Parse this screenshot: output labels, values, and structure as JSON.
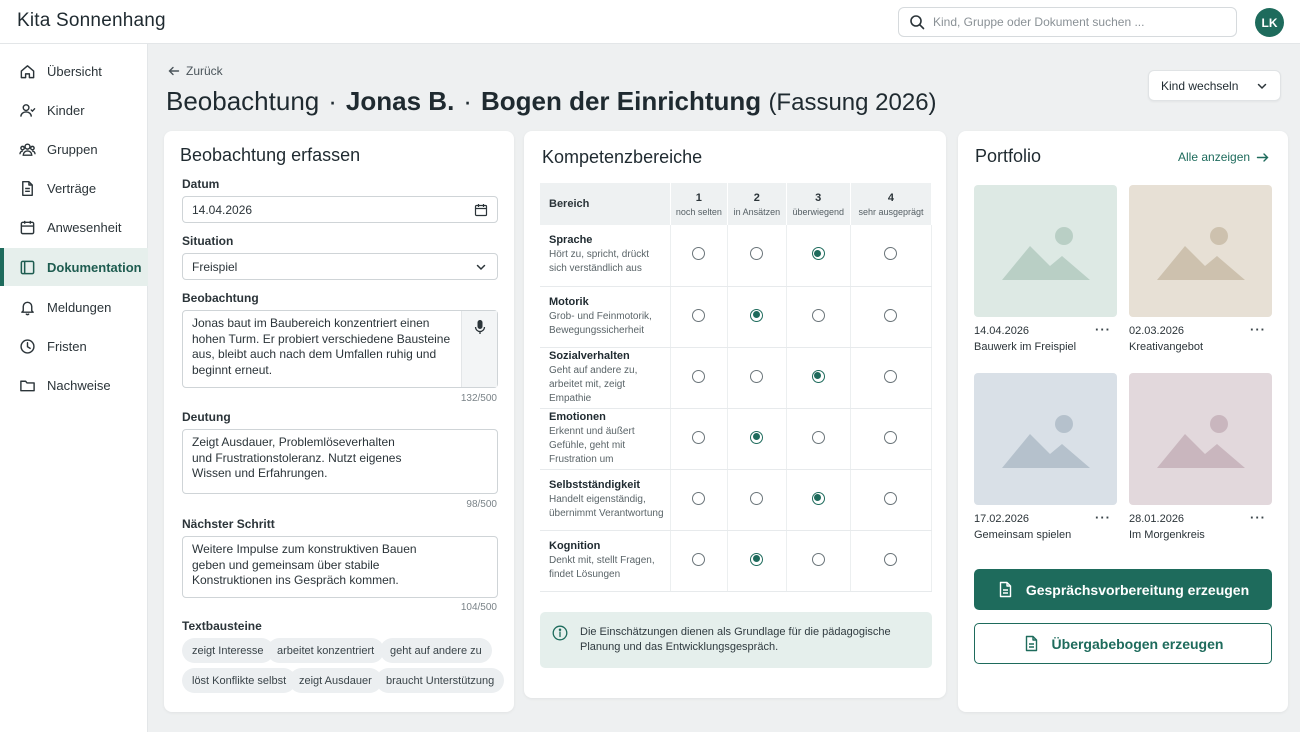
{
  "app": {
    "title": "Kita Sonnenhang",
    "user_initials": "LK"
  },
  "search": {
    "placeholder": "Kind, Gruppe oder Dokument suchen ..."
  },
  "sidebar": {
    "items": [
      {
        "label": "Übersicht",
        "icon": "home-icon"
      },
      {
        "label": "Kinder",
        "icon": "user-icon"
      },
      {
        "label": "Gruppen",
        "icon": "users-icon"
      },
      {
        "label": "Verträge",
        "icon": "document-icon"
      },
      {
        "label": "Anwesenheit",
        "icon": "calendar-icon"
      },
      {
        "label": "Dokumentation",
        "icon": "book-icon",
        "active": true
      },
      {
        "label": "Meldungen",
        "icon": "bell-icon"
      },
      {
        "label": "Fristen",
        "icon": "clock-icon"
      },
      {
        "label": "Nachweise",
        "icon": "folder-icon"
      }
    ]
  },
  "header": {
    "back_label": "Zurück",
    "title_part1": "Beobachtung",
    "title_child": "Jonas B.",
    "title_form": "Bogen der Einrichtung",
    "title_version": "(Fassung 2026)",
    "separator": "·",
    "switch_child_label": "Kind wechseln"
  },
  "form": {
    "heading": "Beobachtung erfassen",
    "date_label": "Datum",
    "date_value": "14.04.2026",
    "situation_label": "Situation",
    "situation_value": "Freispiel",
    "observation_label": "Beobachtung",
    "observation_text": "Jonas baut im Baubereich konzentriert einen hohen Turm. Er probiert verschiedene Bausteine aus, bleibt auch nach dem Umfallen ruhig und beginnt erneut.",
    "observation_count": "132/500",
    "interpretation_label": "Deutung",
    "interpretation_text": "Zeigt Ausdauer, Problemlöseverhalten und Frustrationstoleranz. Nutzt eigenes Wissen und Erfahrungen.",
    "interpretation_count": "98/500",
    "next_step_label": "Nächster Schritt",
    "next_step_text": "Weitere Impulse zum konstruktiven Bauen geben und gemeinsam über stabile Konstruktionen ins Gespräch kommen.",
    "next_step_count": "104/500",
    "snippets_label": "Textbausteine",
    "snippets": [
      "zeigt Interesse",
      "arbeitet konzentriert",
      "geht auf andere zu",
      "löst Konflikte selbst",
      "zeigt Ausdauer",
      "braucht Unterstützung"
    ]
  },
  "competencies": {
    "heading": "Kompetenzbereiche",
    "area_header": "Bereich",
    "levels": [
      {
        "num": "1",
        "desc": "noch selten"
      },
      {
        "num": "2",
        "desc": "in Ansätzen"
      },
      {
        "num": "3",
        "desc": "überwiegend"
      },
      {
        "num": "4",
        "desc": "sehr ausgeprägt"
      }
    ],
    "rows": [
      {
        "name": "Sprache",
        "desc": "Hört zu, spricht, drückt sich verständlich aus",
        "selected": 3
      },
      {
        "name": "Motorik",
        "desc": "Grob- und Feinmotorik, Bewegungssicherheit",
        "selected": 2
      },
      {
        "name": "Sozialverhalten",
        "desc": "Geht auf andere zu, arbeitet mit, zeigt Empathie",
        "selected": 3
      },
      {
        "name": "Emotionen",
        "desc": "Erkennt und äußert Gefühle, geht mit Frustration um",
        "selected": 2
      },
      {
        "name": "Selbstständigkeit",
        "desc": "Handelt eigenständig, übernimmt Verantwortung",
        "selected": 3
      },
      {
        "name": "Kognition",
        "desc": "Denkt mit, stellt Fragen, findet Lösungen",
        "selected": 2
      }
    ],
    "info_text": "Die Einschätzungen dienen als Grundlage für die pädagogische Planung und das Entwicklungsgespräch."
  },
  "portfolio": {
    "heading": "Portfolio",
    "show_all_label": "Alle anzeigen",
    "items": [
      {
        "date": "14.04.2026",
        "title": "Bauwerk im Freispiel",
        "bg": "#dde9e4",
        "fg": "#b9cfc5"
      },
      {
        "date": "02.03.2026",
        "title": "Kreativangebot",
        "bg": "#e7e0d5",
        "fg": "#cdc1ae"
      },
      {
        "date": "17.02.2026",
        "title": "Gemeinsam spielen",
        "bg": "#d9e0e7",
        "fg": "#b5c1cc"
      },
      {
        "date": "28.01.2026",
        "title": "Im Morgenkreis",
        "bg": "#e2d8dc",
        "fg": "#c9b6be"
      }
    ],
    "more_label": "···",
    "primary_button": "Gesprächsvorbereitung erzeugen",
    "secondary_button": "Übergabebogen erzeugen"
  },
  "colors": {
    "accent": "#1e6b5c",
    "accent_light": "#e6efec"
  }
}
